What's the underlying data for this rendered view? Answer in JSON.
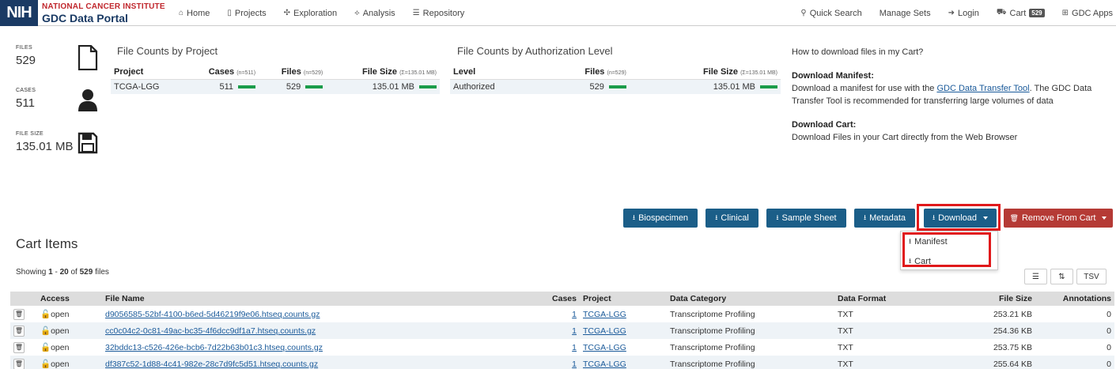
{
  "header": {
    "logo_short": "NIH",
    "logo_line1": "NATIONAL CANCER INSTITUTE",
    "logo_line2": "GDC Data Portal",
    "nav_left": [
      {
        "label": "Home",
        "icon": "home-icon"
      },
      {
        "label": "Projects",
        "icon": "projects-icon"
      },
      {
        "label": "Exploration",
        "icon": "exploration-icon"
      },
      {
        "label": "Analysis",
        "icon": "analysis-icon"
      },
      {
        "label": "Repository",
        "icon": "repository-icon"
      }
    ],
    "nav_right": [
      {
        "label": "Quick Search",
        "icon": "search-icon"
      },
      {
        "label": "Manage Sets",
        "icon": ""
      },
      {
        "label": "Login",
        "icon": "login-icon"
      },
      {
        "label": "Cart",
        "icon": "cart-icon",
        "badge": "529"
      },
      {
        "label": "GDC Apps",
        "icon": "apps-icon"
      }
    ]
  },
  "summary": {
    "files_label": "FILES",
    "files_value": "529",
    "cases_label": "CASES",
    "cases_value": "511",
    "size_label": "FILE SIZE",
    "size_value": "135.01 MB"
  },
  "project_counts": {
    "title": "File Counts by Project",
    "headers": {
      "project": "Project",
      "cases": "Cases",
      "cases_sub": "(n=511)",
      "files": "Files",
      "files_sub": "(n=529)",
      "size": "File Size",
      "size_sub": "(Σ=135.01 MB)"
    },
    "row": {
      "project": "TCGA-LGG",
      "cases": "511",
      "files": "529",
      "size": "135.01 MB"
    }
  },
  "auth_counts": {
    "title": "File Counts by Authorization Level",
    "headers": {
      "level": "Level",
      "files": "Files",
      "files_sub": "(n=529)",
      "size": "File Size",
      "size_sub": "(Σ=135.01 MB)"
    },
    "row": {
      "level": "Authorized",
      "files": "529",
      "size": "135.01 MB"
    }
  },
  "help": {
    "question": "How to download files in my Cart?",
    "manifest_title": "Download Manifest:",
    "manifest_text1": "Download a manifest for use with the ",
    "manifest_link": "GDC Data Transfer Tool",
    "manifest_text2": ". The GDC Data Transfer Tool is recommended for transferring large volumes of data",
    "cart_title": "Download Cart:",
    "cart_text": "Download Files in your Cart directly from the Web Browser"
  },
  "actions": {
    "biospecimen": "Biospecimen",
    "clinical": "Clinical",
    "sample_sheet": "Sample Sheet",
    "metadata": "Metadata",
    "download": "Download",
    "remove": "Remove From Cart"
  },
  "download_menu": {
    "manifest": "Manifest",
    "cart": "Cart"
  },
  "cart": {
    "title": "Cart Items",
    "showing_prefix": "Showing ",
    "showing_start": "1",
    "showing_mid": " - ",
    "showing_end": "20",
    "showing_of": " of ",
    "showing_total": "529",
    "showing_suffix": " files",
    "tsv": "TSV",
    "columns": [
      "",
      "Access",
      "File Name",
      "Cases",
      "Project",
      "Data Category",
      "Data Format",
      "File Size",
      "Annotations"
    ],
    "rows": [
      {
        "access": "open",
        "file": "d9056585-52bf-4100-b6ed-5d46219f9e06.htseq.counts.gz",
        "cases": "1",
        "project": "TCGA-LGG",
        "category": "Transcriptome Profiling",
        "format": "TXT",
        "size": "253.21 KB",
        "annotations": "0"
      },
      {
        "access": "open",
        "file": "cc0c04c2-0c81-49ac-bc35-4f6dcc9df1a7.htseq.counts.gz",
        "cases": "1",
        "project": "TCGA-LGG",
        "category": "Transcriptome Profiling",
        "format": "TXT",
        "size": "254.36 KB",
        "annotations": "0"
      },
      {
        "access": "open",
        "file": "32bddc13-c526-426e-bcb6-7d22b63b01c3.htseq.counts.gz",
        "cases": "1",
        "project": "TCGA-LGG",
        "category": "Transcriptome Profiling",
        "format": "TXT",
        "size": "253.75 KB",
        "annotations": "0"
      },
      {
        "access": "open",
        "file": "df387c52-1d88-4c41-982e-28c7d9fc5d51.htseq.counts.gz",
        "cases": "1",
        "project": "TCGA-LGG",
        "category": "Transcriptome Profiling",
        "format": "TXT",
        "size": "255.64 KB",
        "annotations": "0"
      }
    ]
  },
  "colors": {
    "primary_blue": "#1b5e88",
    "danger_red": "#b53a35",
    "highlight_red": "#e0191b",
    "bar_green": "#1a9c4a",
    "nih_navy": "#1a3a64"
  }
}
